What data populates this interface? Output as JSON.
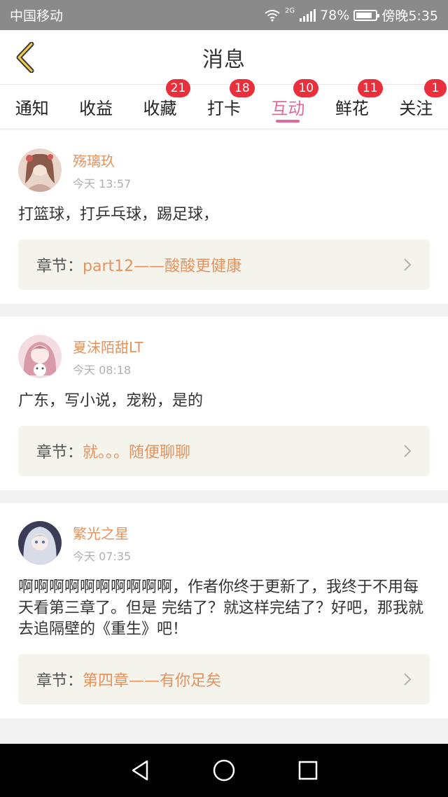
{
  "status_bar": {
    "carrier": "中国移动",
    "network": "2G",
    "battery": "78%",
    "time": "傍晚5:35"
  },
  "header": {
    "title": "消息",
    "back_icon": "chevron-left-icon"
  },
  "tabs": [
    {
      "label": "通知",
      "badge": ""
    },
    {
      "label": "收益",
      "badge": ""
    },
    {
      "label": "收藏",
      "badge": "21"
    },
    {
      "label": "打卡",
      "badge": "18"
    },
    {
      "label": "互动",
      "badge": "10",
      "active": true
    },
    {
      "label": "鲜花",
      "badge": "11"
    },
    {
      "label": "关注",
      "badge": "1"
    }
  ],
  "colors": {
    "accent": "#e06a98",
    "username": "#e4935e",
    "badge": "#ea2f3c"
  },
  "messages": [
    {
      "username": "殇璃玖",
      "time": "今天 13:57",
      "content": "打篮球，打乒乓球，踢足球，",
      "chapter_label": "章节：",
      "chapter_title": "part12——酸酸更健康"
    },
    {
      "username": "夏沫陌甜LT",
      "time": "今天 08:18",
      "content": "广东，写小说，宠粉，是的",
      "chapter_label": "章节：",
      "chapter_title": "就。。。随便聊聊"
    },
    {
      "username": "繁光之星",
      "time": "今天 07:35",
      "content": "啊啊啊啊啊啊啊啊啊啊，作者你终于更新了，我终于不用每天看第三章了。但是 完结了？就这样完结了？好吧，那我就去追隔壁的《重生》吧！",
      "chapter_label": "章节：",
      "chapter_title": "第四章——有你足矣"
    }
  ],
  "nav": [
    "back-triangle-icon",
    "home-circle-icon",
    "recents-square-icon"
  ]
}
